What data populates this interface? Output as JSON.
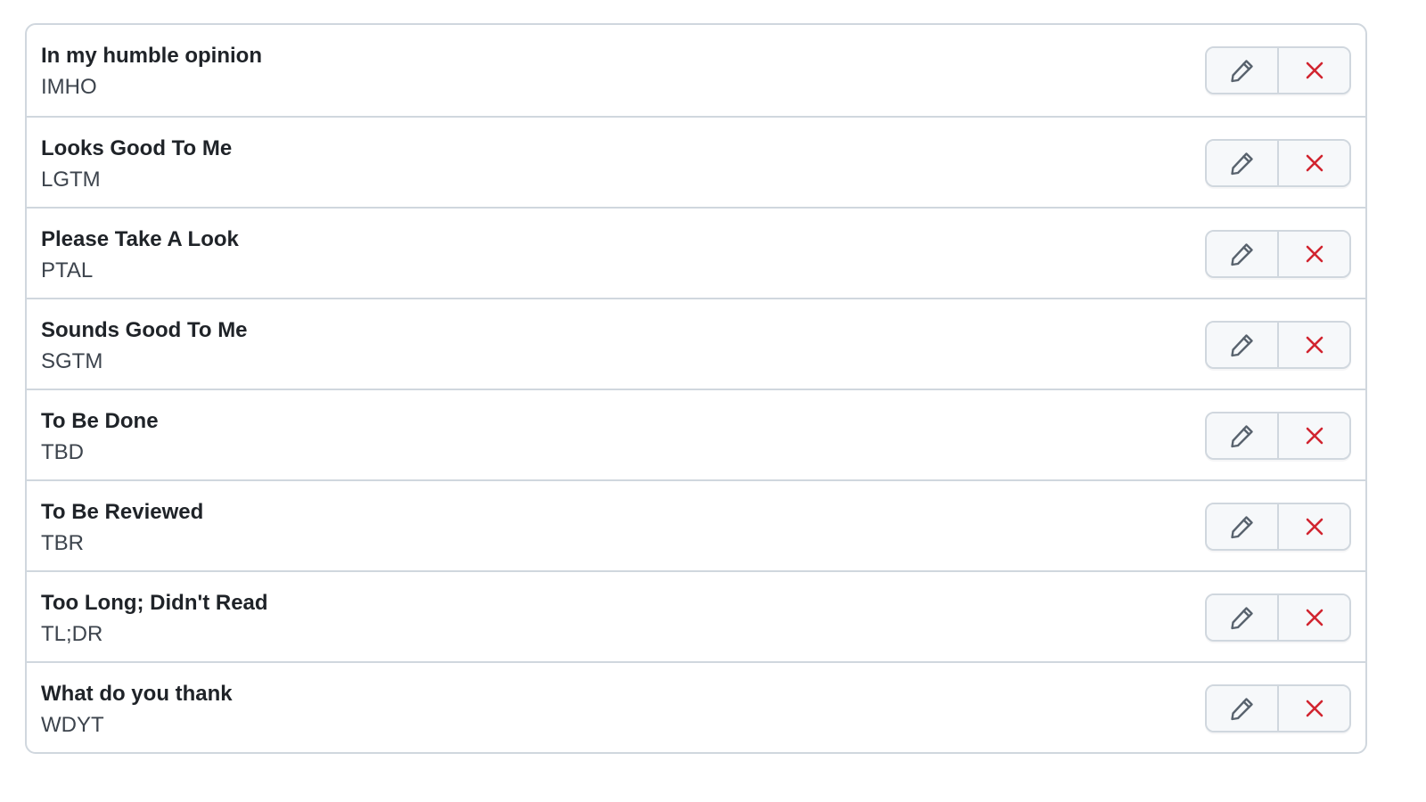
{
  "colors": {
    "border": "#d0d7de",
    "title": "#1f2328",
    "subtitle": "#3d444d",
    "edit_icon": "#59636e",
    "delete_icon": "#d1242f",
    "button_bg": "#f6f8fa"
  },
  "icons": {
    "edit": "pencil-icon",
    "delete": "x-icon"
  },
  "replies": [
    {
      "title": "In my humble opinion",
      "abbreviation": "IMHO"
    },
    {
      "title": "Looks Good To Me",
      "abbreviation": "LGTM"
    },
    {
      "title": "Please Take A Look",
      "abbreviation": "PTAL"
    },
    {
      "title": "Sounds Good To Me",
      "abbreviation": "SGTM"
    },
    {
      "title": "To Be Done",
      "abbreviation": "TBD"
    },
    {
      "title": "To Be Reviewed",
      "abbreviation": "TBR"
    },
    {
      "title": "Too Long; Didn't Read",
      "abbreviation": "TL;DR"
    },
    {
      "title": "What do you thank",
      "abbreviation": "WDYT"
    }
  ]
}
